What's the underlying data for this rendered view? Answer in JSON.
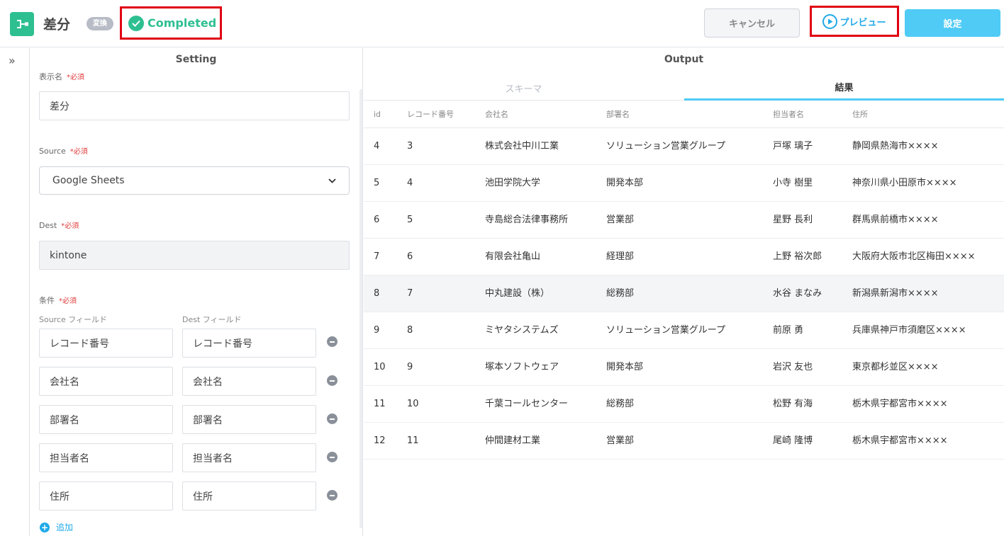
{
  "header": {
    "title": "差分",
    "type_badge": "変換",
    "status": "Completed",
    "cancel_label": "キャンセル",
    "preview_label": "プレビュー",
    "save_label": "設定"
  },
  "colors": {
    "accent_green": "#2ebf91",
    "accent_blue": "#4fcbf5",
    "link_blue": "#1fa9e8",
    "highlight_red": "#e00012"
  },
  "setting": {
    "title": "Setting",
    "required_mark": "*必須",
    "display_name_label": "表示名",
    "display_name_value": "差分",
    "source_label": "Source",
    "source_value": "Google Sheets",
    "dest_label": "Dest",
    "dest_value": "kintone",
    "condition_label": "条件",
    "source_field_label": "Source フィールド",
    "dest_field_label": "Dest フィールド",
    "conditions": [
      {
        "source": "レコード番号",
        "dest": "レコード番号"
      },
      {
        "source": "会社名",
        "dest": "会社名"
      },
      {
        "source": "部署名",
        "dest": "部署名"
      },
      {
        "source": "担当者名",
        "dest": "担当者名"
      },
      {
        "source": "住所",
        "dest": "住所"
      }
    ],
    "add_label": "追加"
  },
  "output": {
    "title": "Output",
    "tabs": [
      {
        "label": "スキーマ",
        "active": false
      },
      {
        "label": "結果",
        "active": true
      }
    ],
    "columns": [
      "id",
      "レコード番号",
      "会社名",
      "部署名",
      "担当者名",
      "住所"
    ],
    "rows": [
      [
        "4",
        "3",
        "株式会社中川工業",
        "ソリューション営業グループ",
        "戸塚 璃子",
        "静岡県熱海市××××"
      ],
      [
        "5",
        "4",
        "池田学院大学",
        "開発本部",
        "小寺 樹里",
        "神奈川県小田原市××××"
      ],
      [
        "6",
        "5",
        "寺島総合法律事務所",
        "営業部",
        "星野 長利",
        "群馬県前橋市××××"
      ],
      [
        "7",
        "6",
        "有限会社亀山",
        "経理部",
        "上野 裕次郎",
        "大阪府大阪市北区梅田××××"
      ],
      [
        "8",
        "7",
        "中丸建設（株）",
        "総務部",
        "水谷 まなみ",
        "新潟県新潟市××××"
      ],
      [
        "9",
        "8",
        "ミヤタシステムズ",
        "ソリューション営業グループ",
        "前原 勇",
        "兵庫県神戸市須磨区××××"
      ],
      [
        "10",
        "9",
        "塚本ソフトウェア",
        "開発本部",
        "岩沢 友也",
        "東京都杉並区××××"
      ],
      [
        "11",
        "10",
        "千葉コールセンター",
        "総務部",
        "松野 有海",
        "栃木県宇都宮市××××"
      ],
      [
        "12",
        "11",
        "仲間建材工業",
        "営業部",
        "尾崎 隆博",
        "栃木県宇都宮市××××"
      ]
    ],
    "highlighted_row": 4
  }
}
